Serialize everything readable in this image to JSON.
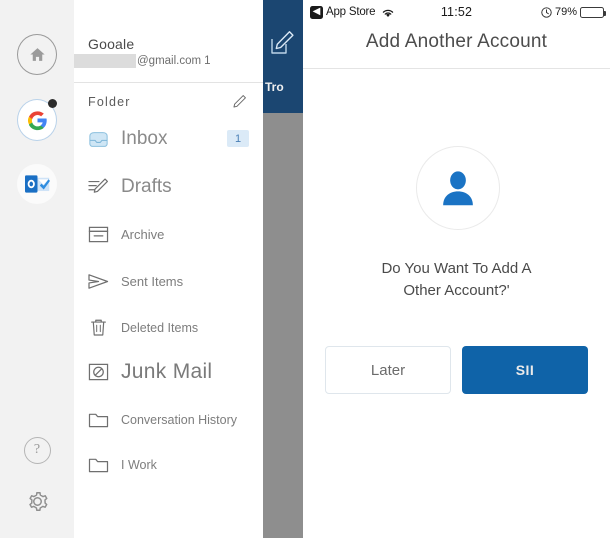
{
  "left_pane": {
    "rail": {
      "items": [
        {
          "name": "home",
          "icon": "home-icon"
        },
        {
          "name": "google-account",
          "icon": "google-logo-icon",
          "selected": true,
          "has_notification": true
        },
        {
          "name": "outlook-account",
          "icon": "outlook-logo-icon"
        }
      ],
      "bottom_items": [
        {
          "name": "help",
          "icon": "help-question-icon",
          "label": "?"
        },
        {
          "name": "settings",
          "icon": "gear-icon"
        }
      ]
    },
    "account": {
      "provider": "Gooale",
      "email_suffix": "@gmail.com",
      "email_trailing": "1"
    },
    "folder_section": {
      "header": "Folder",
      "edit_icon": "pencil-edit-icon",
      "items": [
        {
          "label": "Inbox",
          "icon": "inbox-icon",
          "badge": "1",
          "size": "lg"
        },
        {
          "label": "Drafts",
          "icon": "drafts-pencil-icon",
          "badge": "",
          "size": "lg"
        },
        {
          "label": "Archive",
          "icon": "archive-box-icon",
          "badge": "",
          "size": "md"
        },
        {
          "label": "Sent Items",
          "icon": "sent-paper-plane-icon",
          "badge": "",
          "size": "md"
        },
        {
          "label": "Deleted Items",
          "icon": "trash-icon",
          "badge": "",
          "size": "sm"
        },
        {
          "label": "Junk Mail",
          "icon": "junk-block-icon",
          "badge": "",
          "size": "xl"
        },
        {
          "label": "Conversation History",
          "icon": "folder-icon",
          "badge": "",
          "size": "sm"
        },
        {
          "label": "I Work",
          "icon": "folder-icon",
          "badge": "",
          "size": "sm"
        }
      ]
    },
    "mail_list": {
      "compose_icon": "compose-pencil-icon",
      "clipped_text": "Tro"
    }
  },
  "right_pane": {
    "status_bar": {
      "back_label": "App Store",
      "back_icon": "back-chevron-icon",
      "wifi_icon": "wifi-icon",
      "time": "11:52",
      "alarm_icon": "alarm-clock-icon",
      "battery_percent": "79%",
      "battery_icon": "battery-icon"
    },
    "title": "Add Another Account",
    "avatar_icon": "user-person-icon",
    "question_line1": "Do You Want To Add A",
    "question_line2": "Other Account?'",
    "buttons": {
      "later": "Later",
      "confirm": "SII"
    }
  },
  "colors": {
    "navy_header": "#1b4671",
    "primary_blue": "#0f63a8",
    "badge_bg": "#dbeaf7",
    "avatar_blue": "#1a73c4"
  }
}
